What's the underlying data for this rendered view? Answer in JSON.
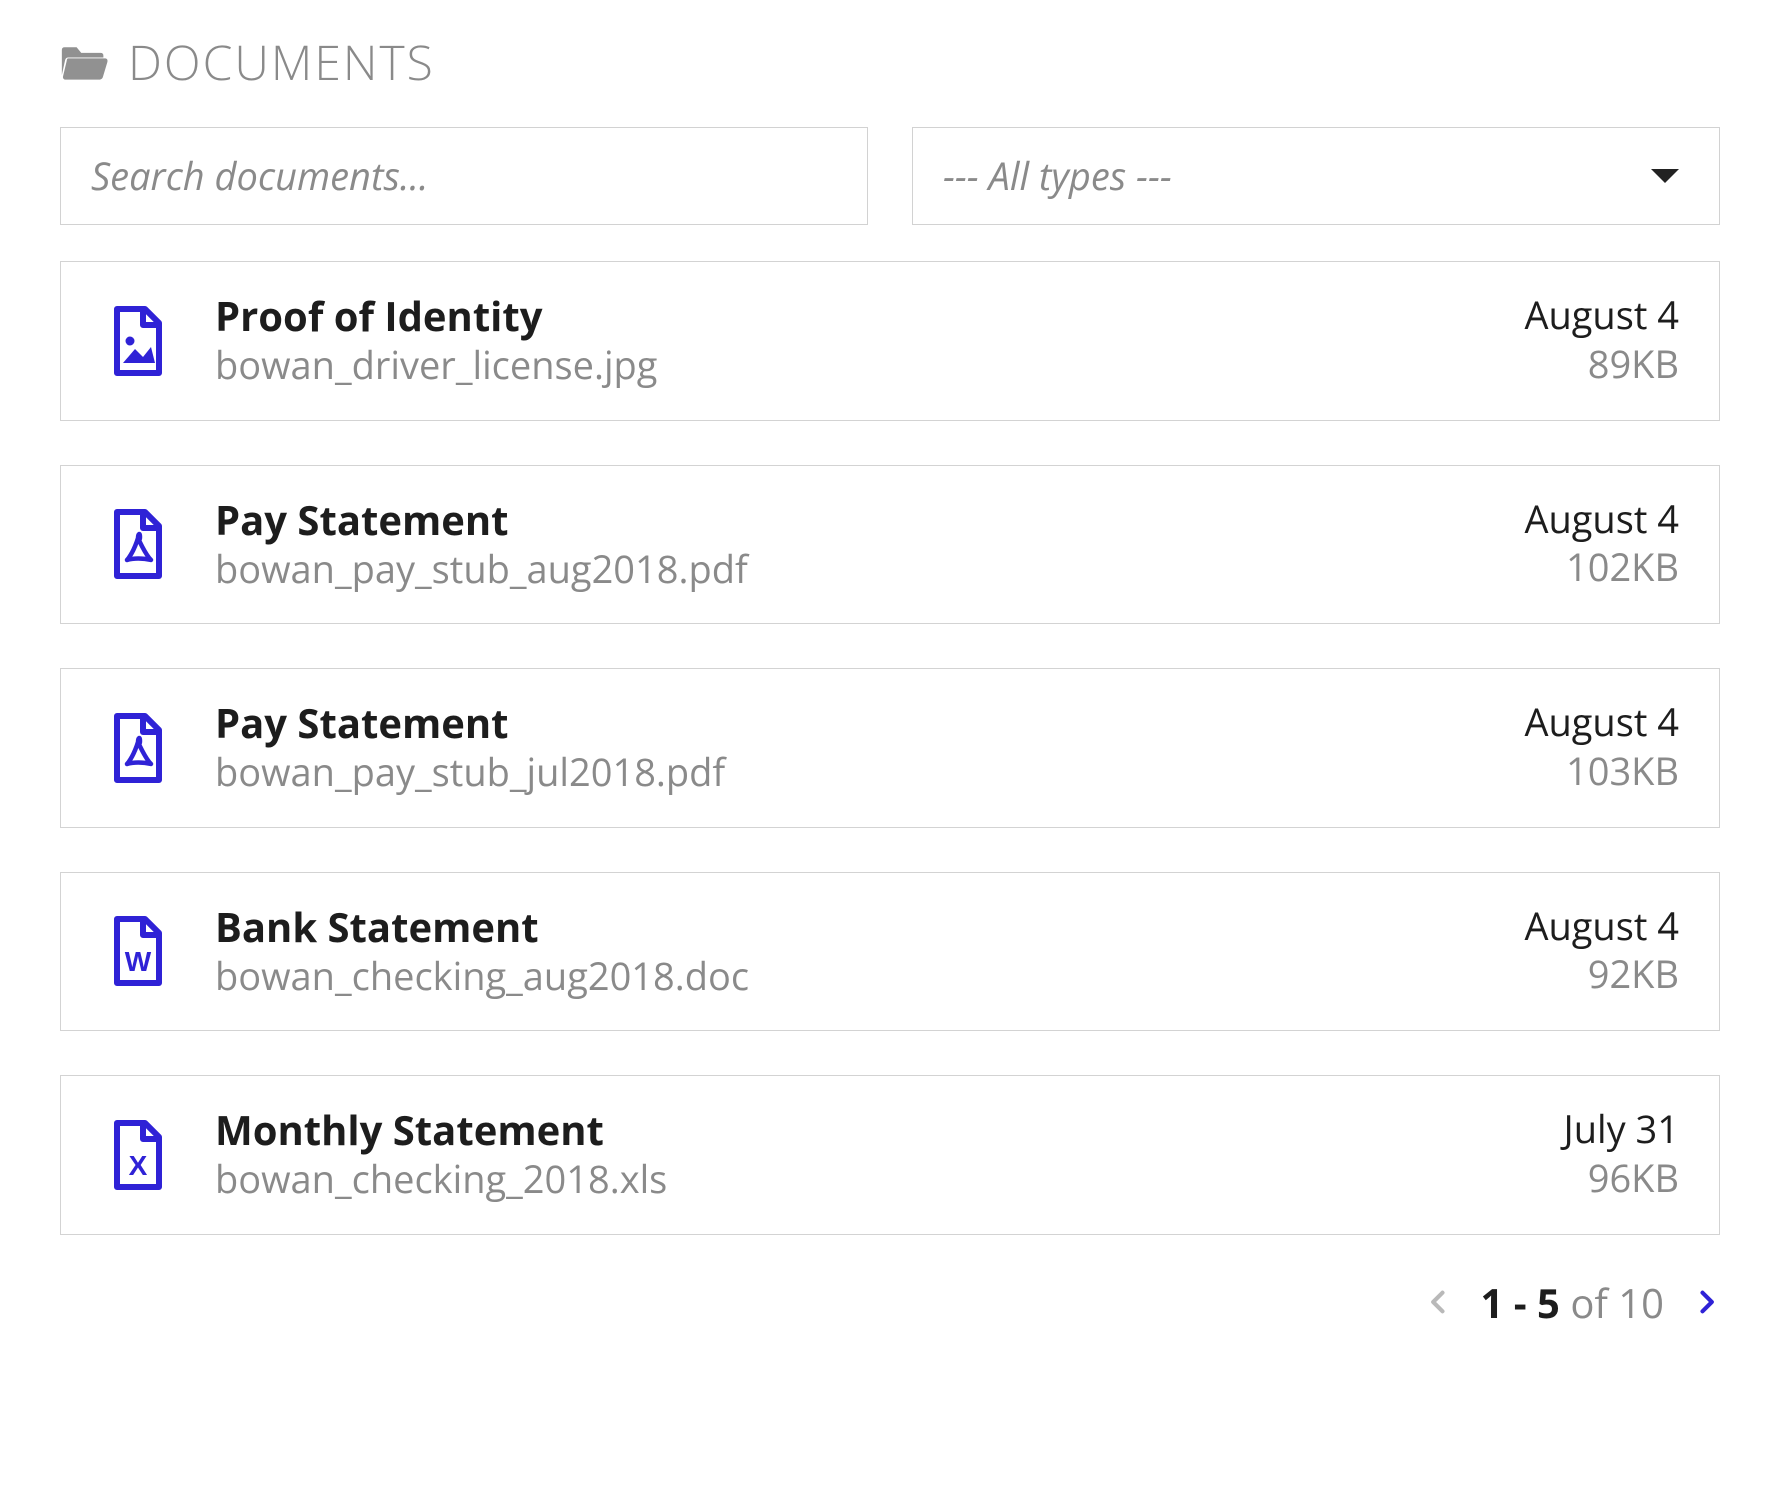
{
  "header": {
    "title": "DOCUMENTS"
  },
  "search": {
    "placeholder": "Search documents..."
  },
  "filter": {
    "selected": "--- All types ---"
  },
  "documents": [
    {
      "icon": "image",
      "title": "Proof of Identity",
      "filename": "bowan_driver_license.jpg",
      "date": "August 4",
      "size": "89KB"
    },
    {
      "icon": "pdf",
      "title": "Pay Statement",
      "filename": "bowan_pay_stub_aug2018.pdf",
      "date": "August 4",
      "size": "102KB"
    },
    {
      "icon": "pdf",
      "title": "Pay Statement",
      "filename": "bowan_pay_stub_jul2018.pdf",
      "date": "August 4",
      "size": "103KB"
    },
    {
      "icon": "word",
      "title": "Bank Statement",
      "filename": "bowan_checking_aug2018.doc",
      "date": "August 4",
      "size": "92KB"
    },
    {
      "icon": "excel",
      "title": "Monthly Statement",
      "filename": "bowan_checking_2018.xls",
      "date": "July 31",
      "size": "96KB"
    }
  ],
  "pagination": {
    "range": "1 - 5",
    "of_label": " of ",
    "total": "10",
    "prev_enabled": false,
    "next_enabled": true
  }
}
